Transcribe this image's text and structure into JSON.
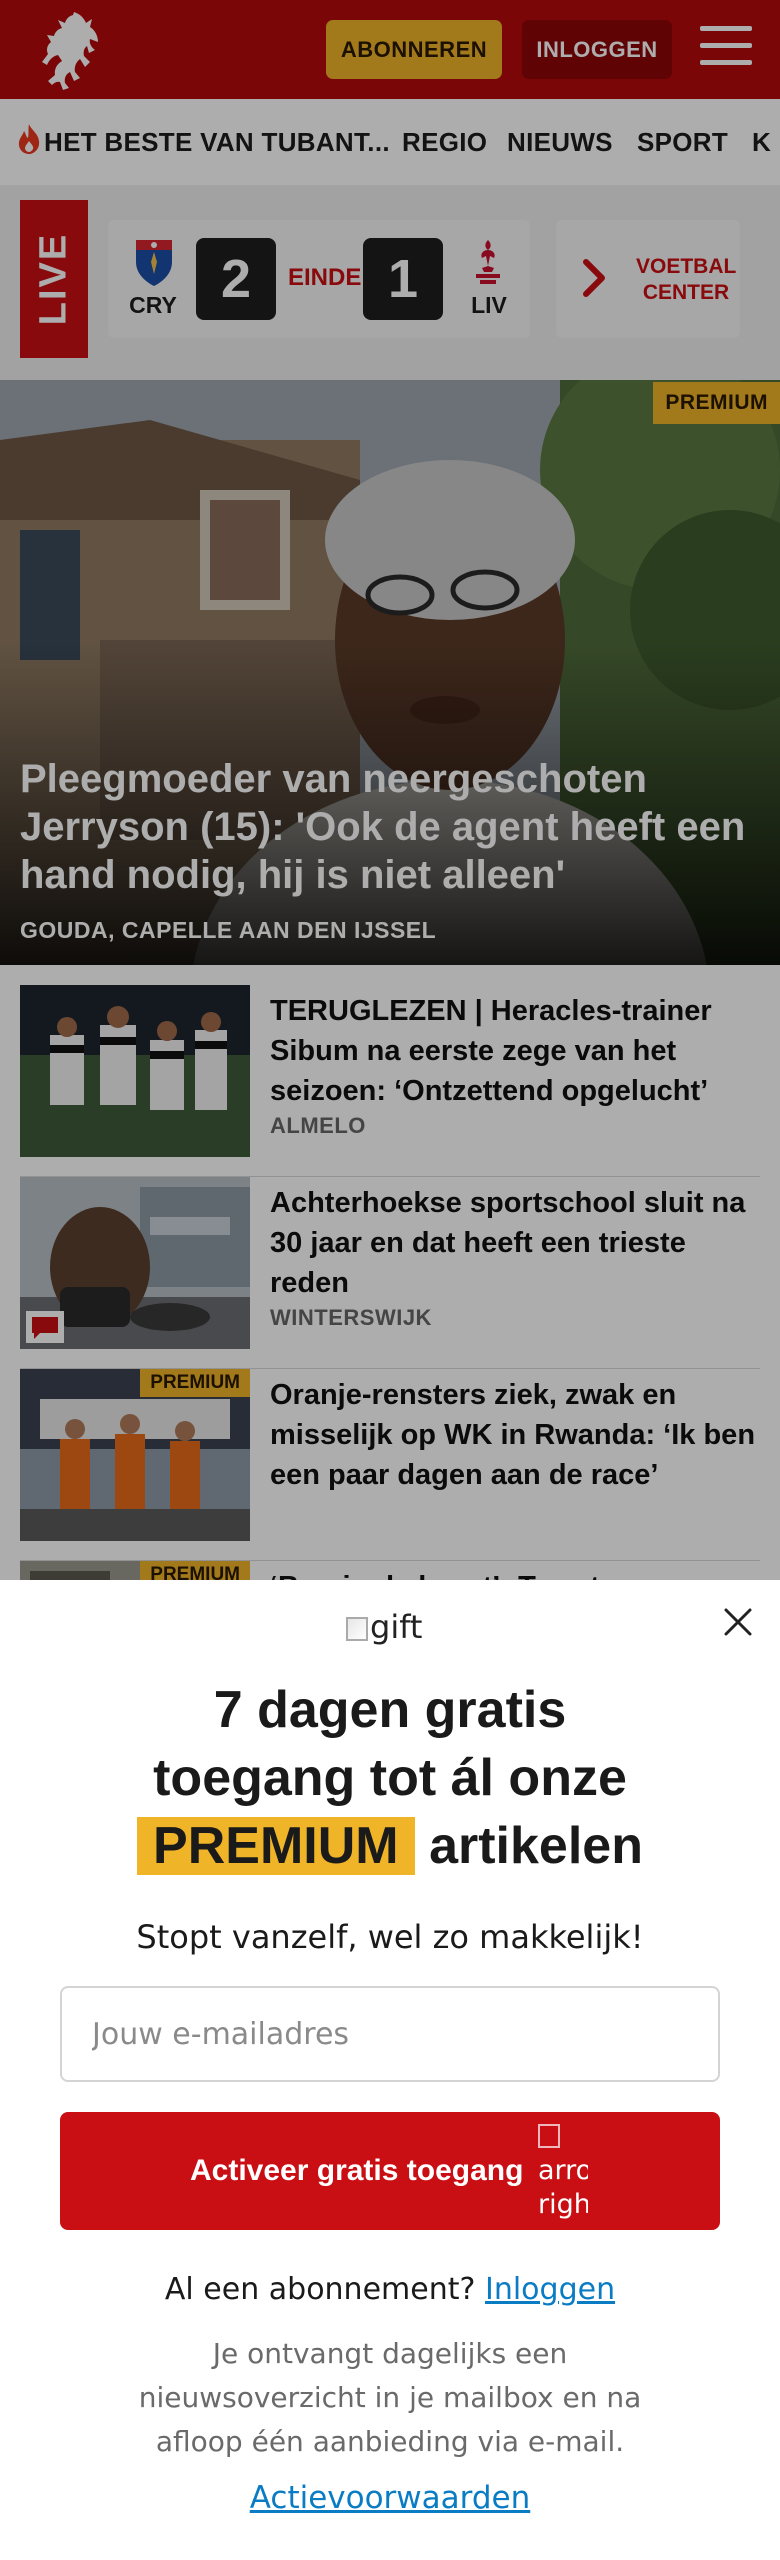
{
  "header": {
    "subscribe_label": "ABONNEREN",
    "login_label": "INLOGGEN",
    "brand_color": "#b4090d"
  },
  "nav": {
    "items": [
      {
        "label": "HET BESTE VAN TUBANT...",
        "icon": "flame-icon"
      },
      {
        "label": "REGIO"
      },
      {
        "label": "NIEUWS"
      },
      {
        "label": "SPORT"
      },
      {
        "label": "K"
      }
    ]
  },
  "live": {
    "label": "LIVE",
    "home": {
      "code": "CRY",
      "score": "2"
    },
    "away": {
      "code": "LIV",
      "score": "1"
    },
    "status": "EINDE",
    "voetbalcenter_label": "VOETBAL CENTER"
  },
  "hero": {
    "badge": "PREMIUM",
    "title": "Pleegmoeder van neergeschoten Jerryson (15): 'Ook de agent heeft een hand nodig, hij is niet alleen'",
    "location": "GOUDA, CAPELLE AAN DEN IJSSEL"
  },
  "articles": [
    {
      "title": "TERUGLEZEN | Heracles-trainer Sibum na eerste zege van het seizoen: ‘Ontzettend opgelucht’",
      "location": "ALMELO",
      "premium": false,
      "comment_icon": false
    },
    {
      "title": "Achterhoekse sportschool sluit na 30 jaar en dat heeft een trieste reden",
      "location": "WINTERSWIJK",
      "premium": false,
      "comment_icon": true
    },
    {
      "title": "Oranje-rensters ziek, zwak en misselijk op WK in Rwanda: ‘Ik ben een paar dagen aan de race’",
      "location": "",
      "premium": true,
      "badge": "PREMIUM",
      "comment_icon": false
    },
    {
      "title": "‘Bon in de buurt’: Twentse",
      "location": "",
      "premium": true,
      "badge": "PREMIUM",
      "comment_icon": false
    }
  ],
  "modal": {
    "gift_alt": "gift",
    "title_line1": "7 dagen gratis",
    "title_line2": "toegang tot ál onze",
    "title_highlight": "PREMIUM",
    "title_line3_rest": "artikelen",
    "subtitle": "Stopt vanzelf, wel zo makkelijk!",
    "email_placeholder": "Jouw e-mailadres",
    "cta_label": "Activeer gratis toegang",
    "cta_icon_alt": "arrow right",
    "already_text": "Al een abonnement?",
    "login_link": "Inloggen",
    "info": "Je ontvangt dagelijks een nieuwsoverzicht in je mailbox en na afloop één aanbieding via e-mail.",
    "terms_link": "Actievoorwaarden"
  }
}
